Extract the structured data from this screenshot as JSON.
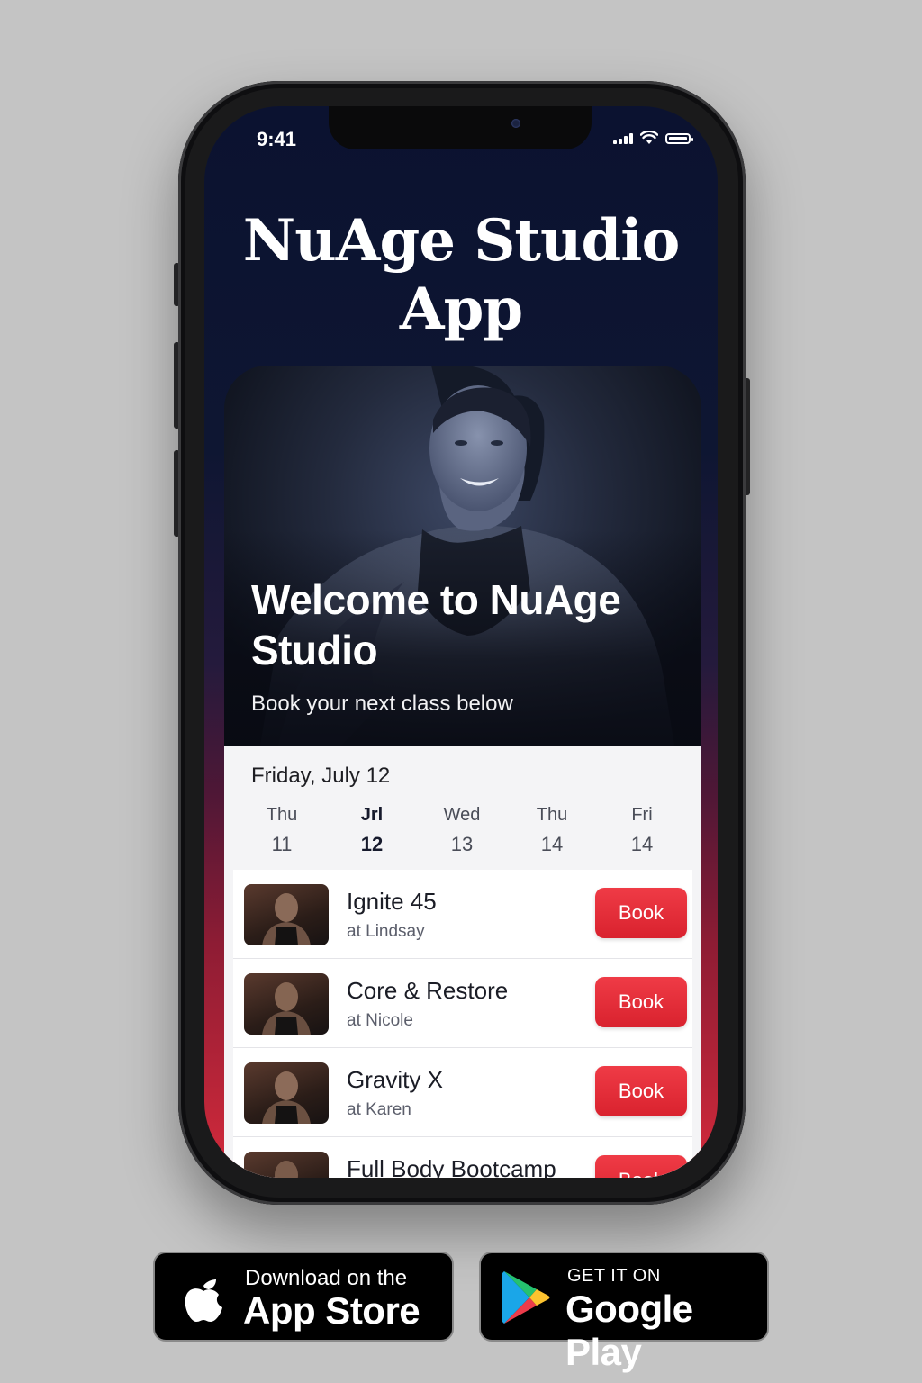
{
  "status_bar": {
    "time": "9:41"
  },
  "app": {
    "title": "NuAge Studio App"
  },
  "hero": {
    "title": "Welcome to NuAge Studio",
    "subtitle": "Book your next class below"
  },
  "schedule": {
    "date_label": "Friday, July 12",
    "days": [
      {
        "name": "Thu",
        "date": "11",
        "selected": false
      },
      {
        "name": "Jrl",
        "date": "12",
        "selected": true
      },
      {
        "name": "Wed",
        "date": "13",
        "selected": false
      },
      {
        "name": "Thu",
        "date": "14",
        "selected": false
      },
      {
        "name": "Fri",
        "date": "14",
        "selected": false
      }
    ],
    "classes": [
      {
        "name": "Ignite 45",
        "instructor": "at Lindsay",
        "button": "Book"
      },
      {
        "name": "Core & Restore",
        "instructor": "at Nicole",
        "button": "Book"
      },
      {
        "name": "Gravity X",
        "instructor": "at Karen",
        "button": "Book"
      },
      {
        "name": "Full Body Bootcamp",
        "instructor": "",
        "button": "Book"
      }
    ]
  },
  "badges": {
    "apple": {
      "small": "Download on the",
      "big": "App Store",
      "icon": "apple-icon"
    },
    "google": {
      "small": "GET IT ON",
      "big": "Google Play",
      "icon": "google-play-icon"
    }
  },
  "colors": {
    "accent": "#e1252f",
    "background": "#c4c4c4",
    "screen_top": "#0b1230"
  }
}
